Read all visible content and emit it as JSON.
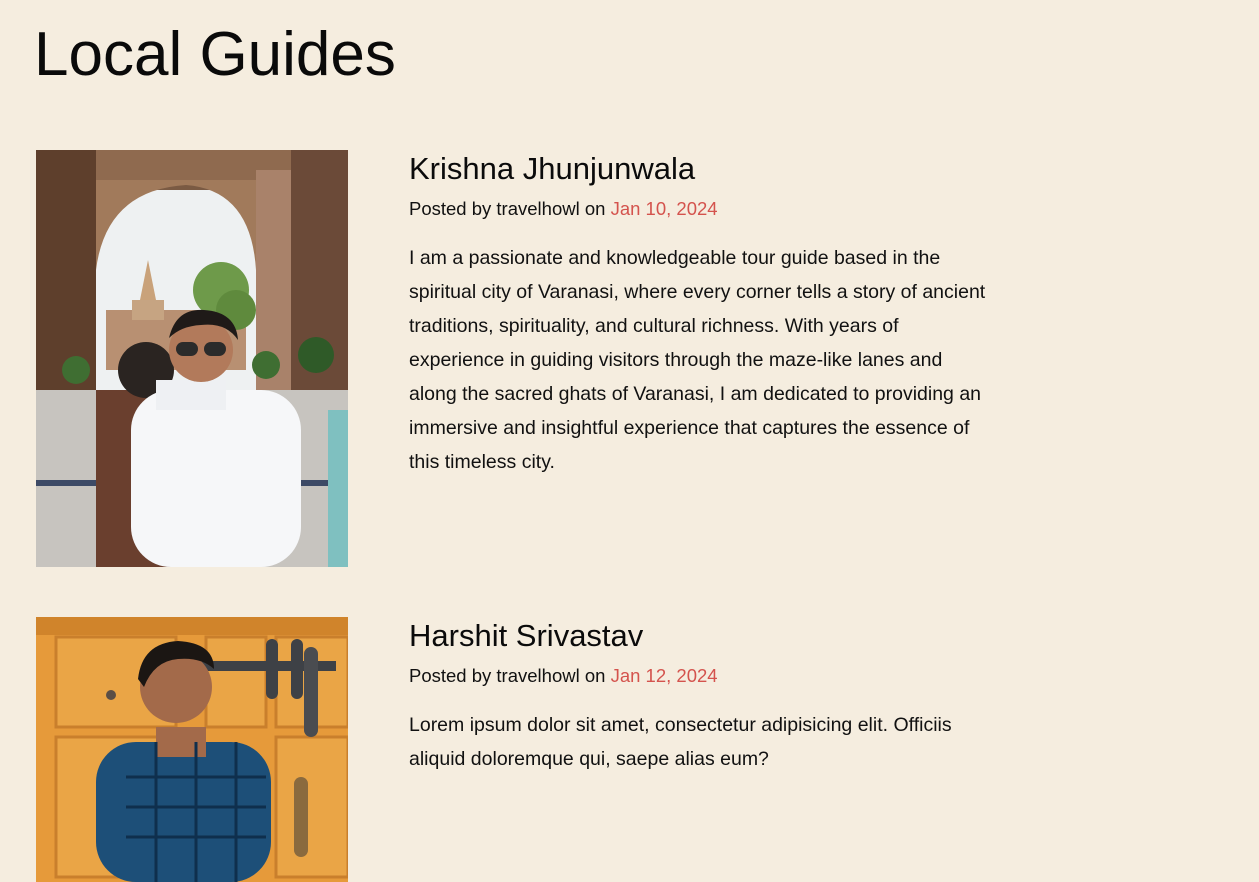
{
  "page": {
    "title": "Local Guides"
  },
  "guides": [
    {
      "name": "Krishna Jhunjunwala",
      "posted_prefix": "Posted by",
      "author": "travelhowl",
      "on_word": "on",
      "date": "Jan 10, 2024",
      "bio": "I am a passionate and knowledgeable tour guide based in the spiritual city of Varanasi, where every corner tells a story of ancient traditions, spirituality, and cultural richness. With years of experience in guiding visitors through the maze-like lanes and along the sacred ghats of Varanasi, I am dedicated to providing an immersive and insightful experience that captures the essence of this timeless city."
    },
    {
      "name": "Harshit Srivastav",
      "posted_prefix": "Posted by",
      "author": "travelhowl",
      "on_word": "on",
      "date": "Jan 12, 2024",
      "bio": "Lorem ipsum dolor sit amet, consectetur adipisicing elit. Officiis aliquid doloremque qui, saepe alias eum?"
    }
  ],
  "colors": {
    "background": "#f5eddf",
    "date_accent": "#d4534d",
    "text": "#111111"
  }
}
